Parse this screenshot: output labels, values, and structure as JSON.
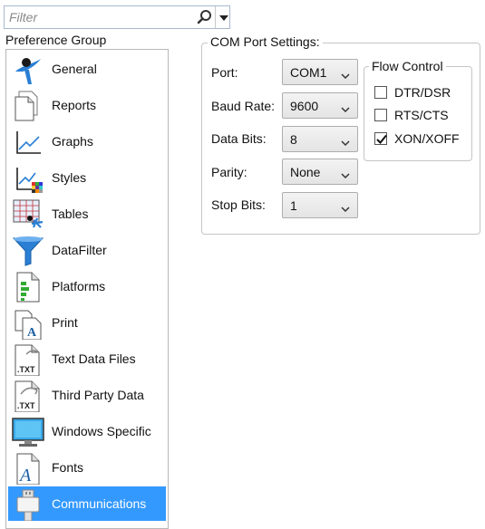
{
  "filter": {
    "placeholder": "Filter",
    "search_icon": "search-icon",
    "dropdown_icon": "chevron-down-icon"
  },
  "preference_group": {
    "label": "Preference Group",
    "items": [
      {
        "label": "General",
        "icon": "general-icon"
      },
      {
        "label": "Reports",
        "icon": "reports-icon"
      },
      {
        "label": "Graphs",
        "icon": "graphs-icon"
      },
      {
        "label": "Styles",
        "icon": "styles-icon"
      },
      {
        "label": "Tables",
        "icon": "tables-icon"
      },
      {
        "label": "DataFilter",
        "icon": "funnel-icon"
      },
      {
        "label": "Platforms",
        "icon": "platforms-icon"
      },
      {
        "label": "Print",
        "icon": "print-icon"
      },
      {
        "label": "Text Data Files",
        "icon": "txt-file-icon"
      },
      {
        "label": "Third Party Data",
        "icon": "txt-import-icon"
      },
      {
        "label": "Windows Specific",
        "icon": "monitor-icon"
      },
      {
        "label": "Fonts",
        "icon": "fonts-icon"
      },
      {
        "label": "Communications",
        "icon": "usb-plug-icon",
        "selected": true
      }
    ]
  },
  "com_port": {
    "title": "COM Port Settings:",
    "fields": [
      {
        "label": "Port:",
        "value": "COM1"
      },
      {
        "label": "Baud Rate:",
        "value": "9600"
      },
      {
        "label": "Data Bits:",
        "value": "8"
      },
      {
        "label": "Parity:",
        "value": "None"
      },
      {
        "label": "Stop Bits:",
        "value": "1"
      }
    ]
  },
  "flow_control": {
    "title": "Flow Control",
    "options": [
      {
        "label": "DTR/DSR",
        "checked": false
      },
      {
        "label": "RTS/CTS",
        "checked": false
      },
      {
        "label": "XON/XOFF",
        "checked": true
      }
    ]
  },
  "colors": {
    "selection": "#3399ff",
    "border": "#c5c5c5"
  }
}
